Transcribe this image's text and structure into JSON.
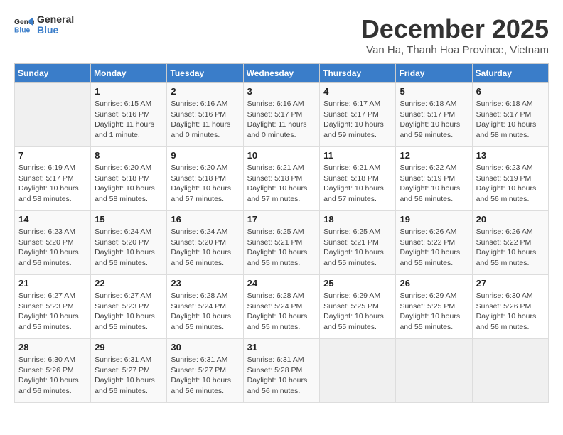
{
  "header": {
    "logo_general": "General",
    "logo_blue": "Blue",
    "title": "December 2025",
    "subtitle": "Van Ha, Thanh Hoa Province, Vietnam"
  },
  "calendar": {
    "days": [
      "Sunday",
      "Monday",
      "Tuesday",
      "Wednesday",
      "Thursday",
      "Friday",
      "Saturday"
    ],
    "weeks": [
      [
        {
          "date": "",
          "info": ""
        },
        {
          "date": "1",
          "info": "Sunrise: 6:15 AM\nSunset: 5:16 PM\nDaylight: 11 hours\nand 1 minute."
        },
        {
          "date": "2",
          "info": "Sunrise: 6:16 AM\nSunset: 5:16 PM\nDaylight: 11 hours\nand 0 minutes."
        },
        {
          "date": "3",
          "info": "Sunrise: 6:16 AM\nSunset: 5:17 PM\nDaylight: 11 hours\nand 0 minutes."
        },
        {
          "date": "4",
          "info": "Sunrise: 6:17 AM\nSunset: 5:17 PM\nDaylight: 10 hours\nand 59 minutes."
        },
        {
          "date": "5",
          "info": "Sunrise: 6:18 AM\nSunset: 5:17 PM\nDaylight: 10 hours\nand 59 minutes."
        },
        {
          "date": "6",
          "info": "Sunrise: 6:18 AM\nSunset: 5:17 PM\nDaylight: 10 hours\nand 58 minutes."
        }
      ],
      [
        {
          "date": "7",
          "info": "Sunrise: 6:19 AM\nSunset: 5:17 PM\nDaylight: 10 hours\nand 58 minutes."
        },
        {
          "date": "8",
          "info": "Sunrise: 6:20 AM\nSunset: 5:18 PM\nDaylight: 10 hours\nand 58 minutes."
        },
        {
          "date": "9",
          "info": "Sunrise: 6:20 AM\nSunset: 5:18 PM\nDaylight: 10 hours\nand 57 minutes."
        },
        {
          "date": "10",
          "info": "Sunrise: 6:21 AM\nSunset: 5:18 PM\nDaylight: 10 hours\nand 57 minutes."
        },
        {
          "date": "11",
          "info": "Sunrise: 6:21 AM\nSunset: 5:18 PM\nDaylight: 10 hours\nand 57 minutes."
        },
        {
          "date": "12",
          "info": "Sunrise: 6:22 AM\nSunset: 5:19 PM\nDaylight: 10 hours\nand 56 minutes."
        },
        {
          "date": "13",
          "info": "Sunrise: 6:23 AM\nSunset: 5:19 PM\nDaylight: 10 hours\nand 56 minutes."
        }
      ],
      [
        {
          "date": "14",
          "info": "Sunrise: 6:23 AM\nSunset: 5:20 PM\nDaylight: 10 hours\nand 56 minutes."
        },
        {
          "date": "15",
          "info": "Sunrise: 6:24 AM\nSunset: 5:20 PM\nDaylight: 10 hours\nand 56 minutes."
        },
        {
          "date": "16",
          "info": "Sunrise: 6:24 AM\nSunset: 5:20 PM\nDaylight: 10 hours\nand 56 minutes."
        },
        {
          "date": "17",
          "info": "Sunrise: 6:25 AM\nSunset: 5:21 PM\nDaylight: 10 hours\nand 55 minutes."
        },
        {
          "date": "18",
          "info": "Sunrise: 6:25 AM\nSunset: 5:21 PM\nDaylight: 10 hours\nand 55 minutes."
        },
        {
          "date": "19",
          "info": "Sunrise: 6:26 AM\nSunset: 5:22 PM\nDaylight: 10 hours\nand 55 minutes."
        },
        {
          "date": "20",
          "info": "Sunrise: 6:26 AM\nSunset: 5:22 PM\nDaylight: 10 hours\nand 55 minutes."
        }
      ],
      [
        {
          "date": "21",
          "info": "Sunrise: 6:27 AM\nSunset: 5:23 PM\nDaylight: 10 hours\nand 55 minutes."
        },
        {
          "date": "22",
          "info": "Sunrise: 6:27 AM\nSunset: 5:23 PM\nDaylight: 10 hours\nand 55 minutes."
        },
        {
          "date": "23",
          "info": "Sunrise: 6:28 AM\nSunset: 5:24 PM\nDaylight: 10 hours\nand 55 minutes."
        },
        {
          "date": "24",
          "info": "Sunrise: 6:28 AM\nSunset: 5:24 PM\nDaylight: 10 hours\nand 55 minutes."
        },
        {
          "date": "25",
          "info": "Sunrise: 6:29 AM\nSunset: 5:25 PM\nDaylight: 10 hours\nand 55 minutes."
        },
        {
          "date": "26",
          "info": "Sunrise: 6:29 AM\nSunset: 5:25 PM\nDaylight: 10 hours\nand 55 minutes."
        },
        {
          "date": "27",
          "info": "Sunrise: 6:30 AM\nSunset: 5:26 PM\nDaylight: 10 hours\nand 56 minutes."
        }
      ],
      [
        {
          "date": "28",
          "info": "Sunrise: 6:30 AM\nSunset: 5:26 PM\nDaylight: 10 hours\nand 56 minutes."
        },
        {
          "date": "29",
          "info": "Sunrise: 6:31 AM\nSunset: 5:27 PM\nDaylight: 10 hours\nand 56 minutes."
        },
        {
          "date": "30",
          "info": "Sunrise: 6:31 AM\nSunset: 5:27 PM\nDaylight: 10 hours\nand 56 minutes."
        },
        {
          "date": "31",
          "info": "Sunrise: 6:31 AM\nSunset: 5:28 PM\nDaylight: 10 hours\nand 56 minutes."
        },
        {
          "date": "",
          "info": ""
        },
        {
          "date": "",
          "info": ""
        },
        {
          "date": "",
          "info": ""
        }
      ]
    ]
  }
}
